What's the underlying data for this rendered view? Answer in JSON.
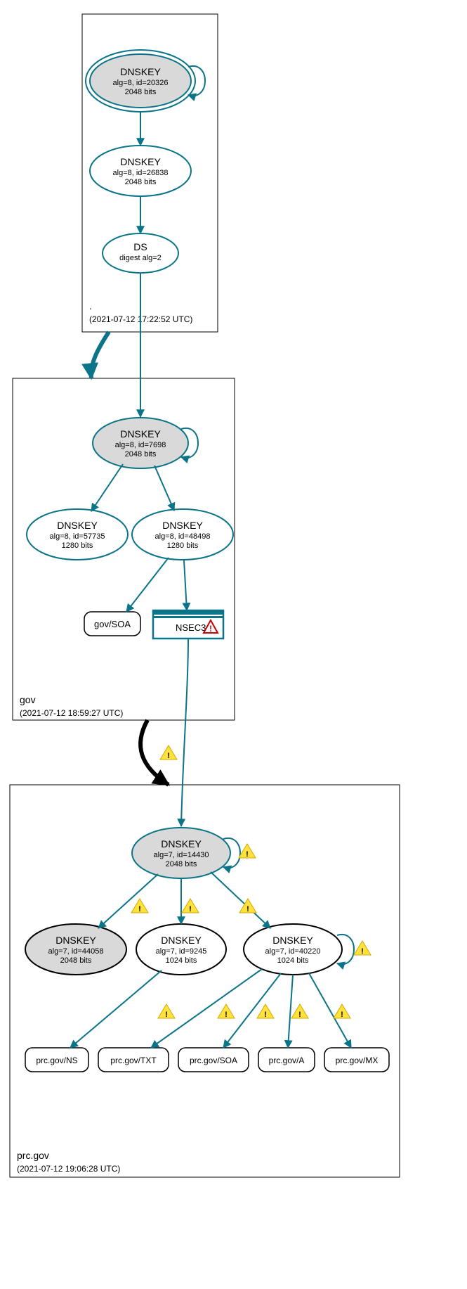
{
  "colors": {
    "teal": "#0c7489",
    "grayFill": "#d9d9d9",
    "white": "#ffffff",
    "black": "#000000"
  },
  "zones": {
    "root": {
      "name": ".",
      "timestamp": "(2021-07-12 17:22:52 UTC)"
    },
    "gov": {
      "name": "gov",
      "timestamp": "(2021-07-12 18:59:27 UTC)"
    },
    "prcgov": {
      "name": "prc.gov",
      "timestamp": "(2021-07-12 19:06:28 UTC)"
    }
  },
  "nodes": {
    "root_ksk": {
      "title": "DNSKEY",
      "line2": "alg=8, id=20326",
      "line3": "2048 bits"
    },
    "root_zsk": {
      "title": "DNSKEY",
      "line2": "alg=8, id=26838",
      "line3": "2048 bits"
    },
    "root_ds": {
      "title": "DS",
      "line2": "digest alg=2",
      "line3": ""
    },
    "gov_ksk": {
      "title": "DNSKEY",
      "line2": "alg=8, id=7698",
      "line3": "2048 bits"
    },
    "gov_zsk1": {
      "title": "DNSKEY",
      "line2": "alg=8, id=57735",
      "line3": "1280 bits"
    },
    "gov_zsk2": {
      "title": "DNSKEY",
      "line2": "alg=8, id=48498",
      "line3": "1280 bits"
    },
    "gov_soa": {
      "label": "gov/SOA"
    },
    "gov_nsec3": {
      "label": "NSEC3"
    },
    "prc_ksk": {
      "title": "DNSKEY",
      "line2": "alg=7, id=14430",
      "line3": "2048 bits"
    },
    "prc_k2": {
      "title": "DNSKEY",
      "line2": "alg=7, id=44058",
      "line3": "2048 bits"
    },
    "prc_k3": {
      "title": "DNSKEY",
      "line2": "alg=7, id=9245",
      "line3": "1024 bits"
    },
    "prc_k4": {
      "title": "DNSKEY",
      "line2": "alg=7, id=40220",
      "line3": "1024 bits"
    },
    "prc_ns": {
      "label": "prc.gov/NS"
    },
    "prc_txt": {
      "label": "prc.gov/TXT"
    },
    "prc_soa": {
      "label": "prc.gov/SOA"
    },
    "prc_a": {
      "label": "prc.gov/A"
    },
    "prc_mx": {
      "label": "prc.gov/MX"
    }
  }
}
